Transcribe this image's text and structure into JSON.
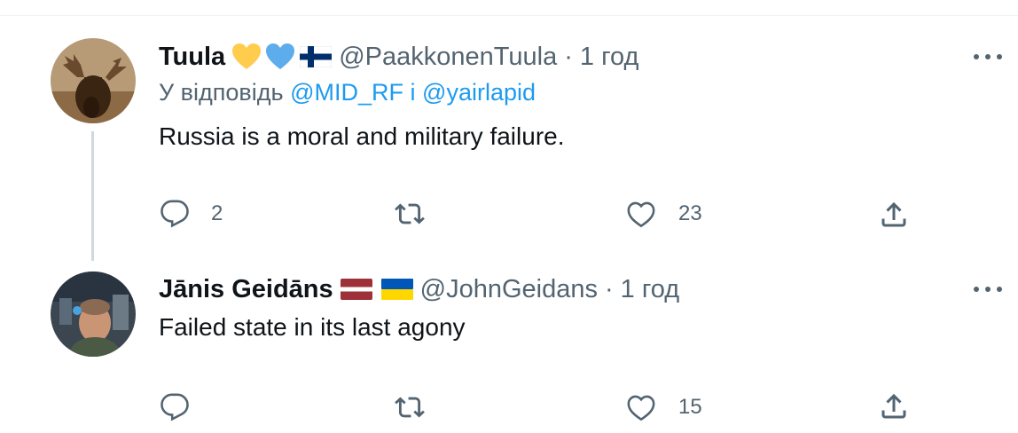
{
  "tweets": [
    {
      "display_name": "Tuula",
      "emojis": [
        "yellow-heart-icon",
        "blue-heart-icon",
        "finland-flag-icon"
      ],
      "handle": "@PaakkonenTuula",
      "separator": "·",
      "time": "1 год",
      "reply_prefix": "У відповідь",
      "reply_to_1": "@MID_RF",
      "reply_conj": "і",
      "reply_to_2": "@yairlapid",
      "text": "Russia is a moral and military failure.",
      "replies": "2",
      "retweets": "",
      "likes": "23"
    },
    {
      "display_name": "Jānis Geidāns",
      "emojis": [
        "latvia-flag-icon",
        "ukraine-flag-icon"
      ],
      "handle": "@JohnGeidans",
      "separator": "·",
      "time": "1 год",
      "text": "Failed state in its last agony",
      "replies": "",
      "retweets": "",
      "likes": "15"
    }
  ],
  "colors": {
    "text_primary": "#0f1419",
    "text_secondary": "#536471",
    "accent": "#1d9bf0",
    "divider": "#eff3f4",
    "thread_line": "#cfd9de",
    "heart_yellow": "#ffcc4d",
    "heart_blue": "#5dadec",
    "latvia_red": "#9e3039",
    "ukraine_blue": "#0057b7",
    "ukraine_yellow": "#ffd700"
  },
  "icons": [
    "comment-icon",
    "retweet-icon",
    "like-icon",
    "share-icon",
    "more-icon"
  ]
}
